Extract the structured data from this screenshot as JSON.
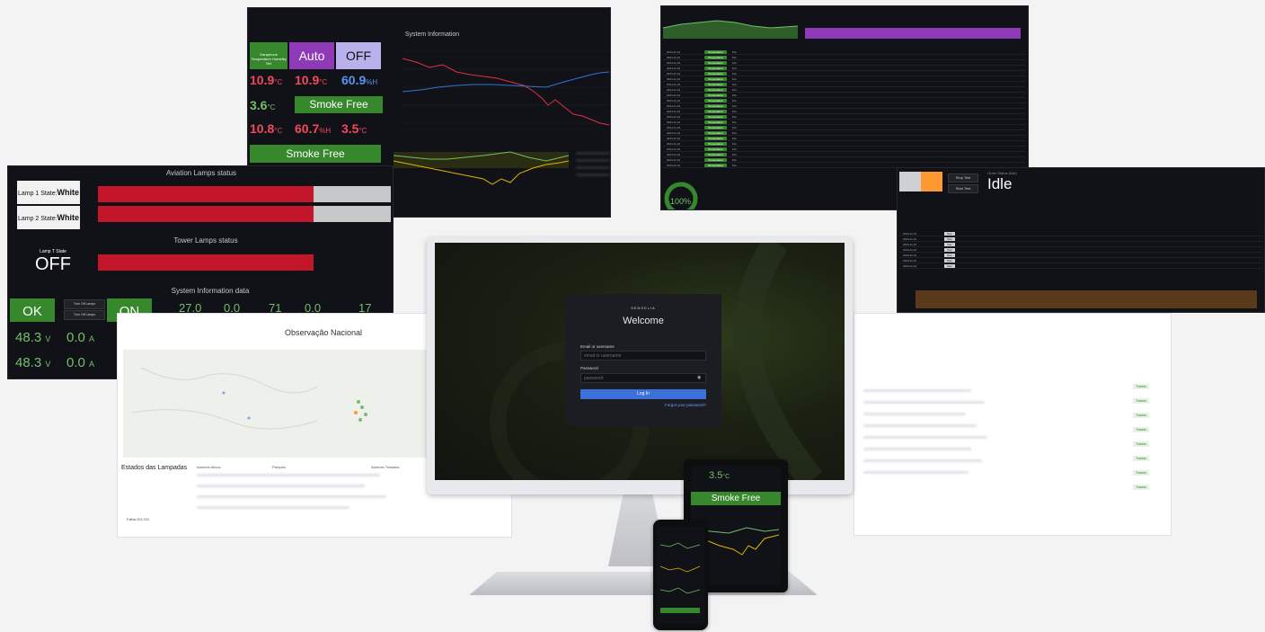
{
  "system_panel": {
    "title": "System Information",
    "tiles": [
      {
        "label": "Dangerous Temperature Humidity Set",
        "value": ""
      },
      {
        "value": "Auto"
      },
      {
        "value": "OFF"
      },
      {
        "value": "10.9",
        "unit": "°C"
      },
      {
        "value": "10.9",
        "unit": "°C"
      },
      {
        "value": "60.9",
        "unit": "%H"
      },
      {
        "value": "3.6",
        "unit": "°C"
      },
      {
        "value": "Smoke Free"
      },
      {
        "value": "10.8",
        "unit": "°C"
      },
      {
        "value": "60.7",
        "unit": "%H"
      },
      {
        "value": "3.5",
        "unit": "°C"
      },
      {
        "value": "Smoke Free"
      }
    ]
  },
  "aviation_panel": {
    "title": "Aviation Lamps status",
    "lamp1_label": "Lamp 1 State:",
    "lamp1_value": "White",
    "lamp2_label": "Lamp 2 State:",
    "lamp2_value": "White",
    "tower_title": "Tower Lamps status",
    "lamp_t_label": "Lamp T State",
    "lamp_t_value": "OFF",
    "sysdata_title": "System Information data",
    "stat_ok": "OK",
    "stat_on": "ON",
    "btn_turn_off": "Turn Off Lamps",
    "btn_turn_off2": "Turn Off Lamps",
    "v1": "48.3",
    "v1_unit": "V",
    "a1": "0.0",
    "a1_unit": "A",
    "v2": "48.3",
    "v2_unit": "V",
    "a2": "0.0",
    "a2_unit": "A",
    "m1": "27.0",
    "m2": "0.0",
    "m3": "71",
    "m4": "0.0",
    "m5": "17"
  },
  "map_panel": {
    "title": "Observação Nacional",
    "estados_title": "Estados das Lampadas",
    "columns": [
      "Alarmes Ativos",
      "Parques",
      "Alarmes Tratados"
    ],
    "legend": [
      "Falha GO-GO"
    ]
  },
  "top_right_panel": {
    "idle_text": "Idle",
    "gauge_value": "100%",
    "order_status": "Order Status (Not)",
    "btn_stop": "Stop Test",
    "btn_start": "Start Test"
  },
  "login": {
    "brand": "SENSELIA",
    "welcome": "Welcome",
    "email_label": "Email or username",
    "email_placeholder": "email or username",
    "password_label": "Password",
    "password_placeholder": "password",
    "login_button": "Log In",
    "forgot_link": "Forgot your password?"
  },
  "tablet": {
    "value": "3.5",
    "unit": "°C",
    "smoke": "Smoke Free"
  },
  "right_panel": {
    "status_labels": [
      "Tratado",
      "Tratado",
      "Tratado",
      "Tratado",
      "Tratado",
      "Tratado",
      "Tratado",
      "Tratado"
    ]
  },
  "colors": {
    "red_value": "#f2495c",
    "green_value": "#73bf69",
    "blue_value": "#5794f2",
    "green_tile": "#37872d",
    "purple_tile": "#8f3bb8",
    "lavender_tile": "#b8b1ec",
    "lamp_red": "#c4162a",
    "login_button": "#3d71d9"
  }
}
